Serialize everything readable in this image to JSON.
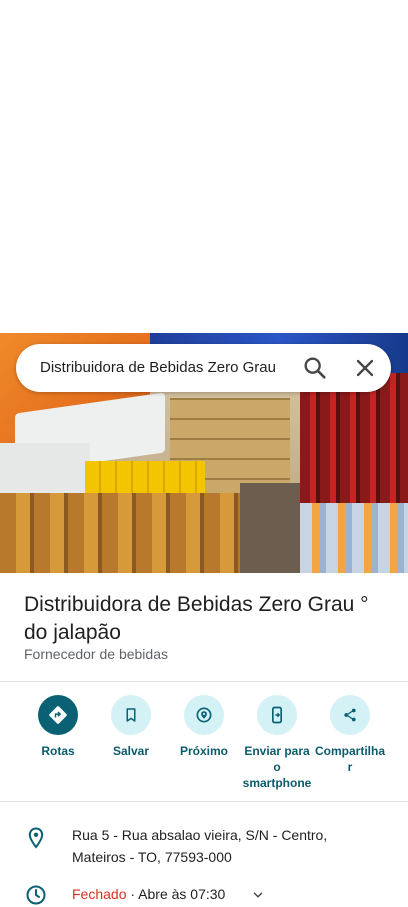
{
  "search": {
    "query": "Distribuidora de Bebidas Zero Grau "
  },
  "place": {
    "name": "Distribuidora de Bebidas Zero Grau ° do jalapão",
    "category": "Fornecedor de bebidas"
  },
  "actions": [
    {
      "label": "Rotas",
      "icon": "directions-icon"
    },
    {
      "label": "Salvar",
      "icon": "bookmark-icon"
    },
    {
      "label": "Próximo",
      "icon": "nearby-icon"
    },
    {
      "label": "Enviar para o smartphone",
      "icon": "send-to-phone-icon"
    },
    {
      "label": "Compartilhar",
      "icon": "share-icon"
    }
  ],
  "details": {
    "address_line1": "Rua 5 - Rua absalao vieira, S/N - Centro,",
    "address_line2": "Mateiros - TO, 77593-000",
    "status": "Fechado",
    "hours": " · Abre às 07:30"
  },
  "colors": {
    "accent": "#0b6174",
    "action_bg": "#d4f1f6",
    "closed": "#d93025"
  }
}
